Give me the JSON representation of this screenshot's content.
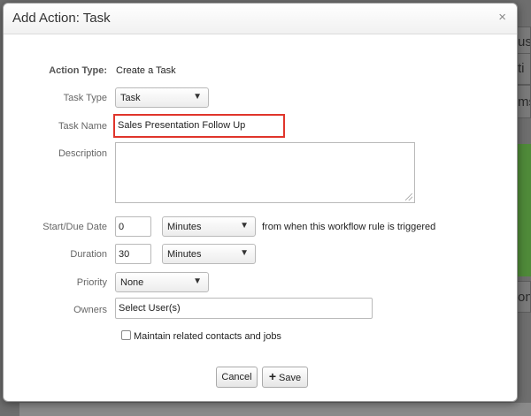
{
  "background": {
    "fragments": [
      "use",
      "ti",
      "ms",
      "ons"
    ]
  },
  "dialog": {
    "title": "Add Action: Task",
    "close_glyph": "×"
  },
  "form": {
    "action_type_label": "Action Type:",
    "action_type_value": "Create a Task",
    "task_type_label": "Task Type",
    "task_type_value": "Task",
    "task_name_label": "Task Name",
    "task_name_value": "Sales Presentation Follow Up",
    "description_label": "Description",
    "description_value": "",
    "start_due_label": "Start/Due Date",
    "start_due_value": "0",
    "start_due_unit": "Minutes",
    "start_due_suffix": "from when this workflow rule is triggered",
    "duration_label": "Duration",
    "duration_value": "30",
    "duration_unit": "Minutes",
    "priority_label": "Priority",
    "priority_value": "None",
    "owners_label": "Owners",
    "owners_value": "Select User(s)",
    "maintain_label": "Maintain related contacts and jobs",
    "maintain_checked": false
  },
  "buttons": {
    "cancel_label": "Cancel",
    "save_label": "Save",
    "save_icon": "+"
  },
  "colors": {
    "highlight": "#e0352b"
  }
}
